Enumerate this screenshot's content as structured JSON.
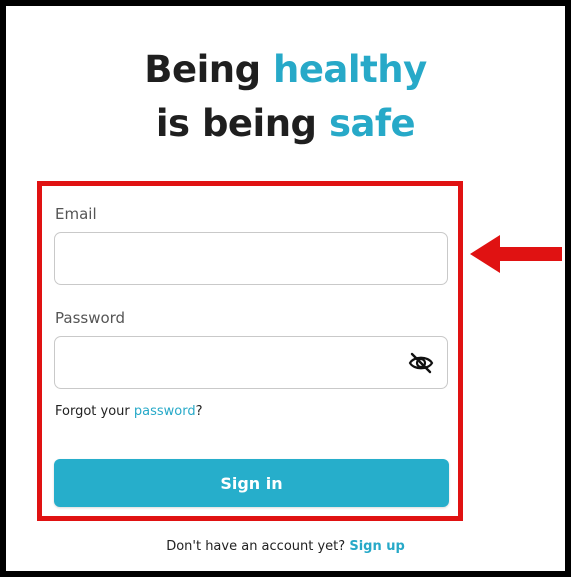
{
  "headline": {
    "line1_prefix": "Being",
    "line1_accent": "healthy",
    "line2_prefix": "is being",
    "line2_accent": "safe"
  },
  "form": {
    "email_label": "Email",
    "email_value": "",
    "password_label": "Password",
    "password_value": "",
    "forgot_prefix": "Forgot your",
    "forgot_link": "password",
    "forgot_suffix": "?",
    "signin_label": "Sign in"
  },
  "footer": {
    "prompt": "Don't have an account yet?",
    "signup_link": "Sign up"
  },
  "icons": {
    "password_toggle": "eye-slash-icon",
    "annotation": "red-arrow-left"
  },
  "colors": {
    "accent": "#27a9c8",
    "button": "#26aecb",
    "highlight": "#e01212",
    "text": "#1f1f1f"
  }
}
